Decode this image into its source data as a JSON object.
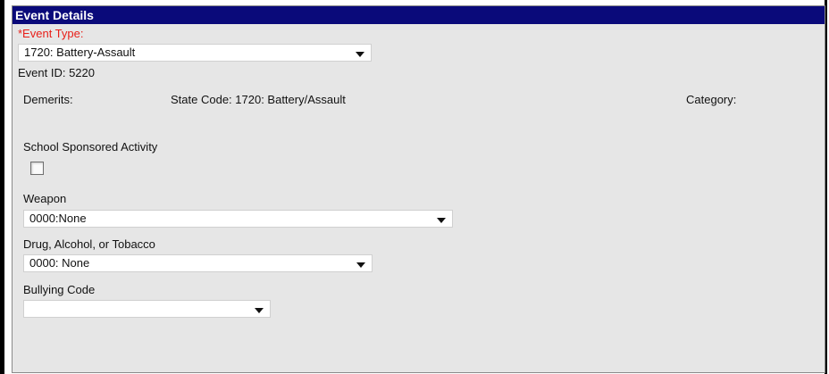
{
  "header": {
    "title": "Event Details"
  },
  "event_type": {
    "label": "*Event Type:",
    "selected": "1720: Battery-Assault"
  },
  "event_id": {
    "text": "Event ID: 5220"
  },
  "info_row": {
    "demerits": "Demerits:",
    "state_code": "State Code: 1720: Battery/Assault",
    "category": "Category:"
  },
  "school_sponsored": {
    "label": "School Sponsored Activity",
    "checked": false
  },
  "weapon": {
    "label": "Weapon",
    "selected": "0000:None"
  },
  "drug": {
    "label": "Drug, Alcohol, or Tobacco",
    "selected": "0000: None"
  },
  "bullying": {
    "label": "Bullying Code",
    "selected": ""
  },
  "colors": {
    "header_bg": "#0a0a7a",
    "panel_bg": "#e6e6e6",
    "required_text": "#e8201a"
  },
  "icons": {
    "dropdown": "chevron-down-icon"
  }
}
